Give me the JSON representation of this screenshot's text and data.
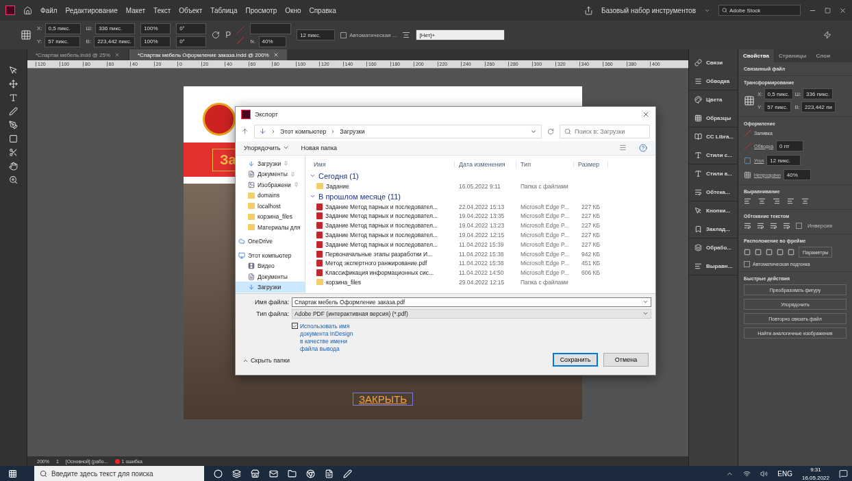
{
  "menu_bar": {
    "items": [
      "Файл",
      "Редактирование",
      "Макет",
      "Текст",
      "Объект",
      "Таблица",
      "Просмотр",
      "Окно",
      "Справка"
    ],
    "workspace": "Базовый набор инструментов",
    "search": {
      "placeholder": "Adobe Stock"
    }
  },
  "control_bar": {
    "fields": [
      {
        "label": "X:",
        "value": "0,5 пикс."
      },
      {
        "label": "Y:",
        "value": "57 пикс."
      },
      {
        "label": "Ш:",
        "value": "336 пикс."
      },
      {
        "label": "В:",
        "value": "223,442 пикс."
      }
    ],
    "scales": [
      "100%",
      "100%"
    ],
    "angles": [
      "0°",
      "0°"
    ],
    "glyph": "P",
    "fx": "fx.",
    "opacity": "40%",
    "corner": "12 пикс.",
    "autofit": {
      "label": "Автоматическая ...",
      "checked": false
    },
    "style": "[Нет]+"
  },
  "document_tabs": [
    {
      "label": "*Спартак мебель.indd @ 25%",
      "selected": false
    },
    {
      "label": "*Спартак мебель Оформление заказа.indd @ 200%",
      "selected": true
    }
  ],
  "ruler": [
    "120",
    "100",
    "80",
    "60",
    "40",
    "20",
    "0",
    "20",
    "40",
    "60",
    "80",
    "100",
    "120",
    "140",
    "160",
    "180",
    "200",
    "220",
    "240",
    "260",
    "280",
    "300",
    "320",
    "340",
    "360",
    "380",
    "400"
  ],
  "page": {
    "banner_text": "За",
    "button_text": "ЗАКРЫТЬ"
  },
  "status_bar": {
    "zoom": "200%",
    "page": "1",
    "master": "[Основной] (рабо...",
    "errors": "1 ошибка"
  },
  "dialog": {
    "title": "Экспорт",
    "path": [
      "Этот компьютер",
      "Загрузки"
    ],
    "search": {
      "placeholder": "Поиск в: Загрузки"
    },
    "organize": "Упорядочить",
    "new_folder": "Новая папка",
    "nav": [
      {
        "label": "Загрузки",
        "kind": "download",
        "pinned": true,
        "selected": false
      },
      {
        "label": "Документы",
        "kind": "document",
        "pinned": true,
        "selected": false
      },
      {
        "label": "Изображени",
        "kind": "image",
        "pinned": true,
        "selected": false
      },
      {
        "label": "domains",
        "kind": "folder",
        "pinned": false,
        "selected": false
      },
      {
        "label": "localhost",
        "kind": "folder",
        "pinned": false,
        "selected": false
      },
      {
        "label": "корзина_files",
        "kind": "folder",
        "pinned": false,
        "selected": false
      },
      {
        "label": "Материалы для",
        "kind": "folder",
        "pinned": false,
        "selected": false
      },
      {
        "label": "OneDrive",
        "kind": "cloud",
        "pinned": false,
        "selected": false
      },
      {
        "label": "Этот компьютер",
        "kind": "computer",
        "pinned": false,
        "selected": false
      },
      {
        "label": "Видео",
        "kind": "video",
        "pinned": false,
        "selected": false
      },
      {
        "label": "Документы",
        "kind": "document",
        "pinned": false,
        "selected": false
      },
      {
        "label": "Загрузки",
        "kind": "download",
        "pinned": false,
        "selected": true
      }
    ],
    "columns": [
      "Имя",
      "Дата изменения",
      "Тип",
      "Размер"
    ],
    "groups": [
      {
        "label": "Сегодня (1)",
        "rows": [
          {
            "name": "Задание",
            "kind": "folder",
            "date": "16.05.2022 9:11",
            "type": "Папка с файлами",
            "size": ""
          }
        ]
      },
      {
        "label": "В прошлом месяце (11)",
        "rows": [
          {
            "name": "Задание Метод парных и последовател...",
            "kind": "pdf",
            "date": "22.04.2022 15:13",
            "type": "Microsoft Edge P...",
            "size": "227 КБ"
          },
          {
            "name": "Задание Метод парных и последовател...",
            "kind": "pdf",
            "date": "19.04.2022 13:35",
            "type": "Microsoft Edge P...",
            "size": "227 КБ"
          },
          {
            "name": "Задание Метод парных и последовател...",
            "kind": "pdf",
            "date": "19.04.2022 13:23",
            "type": "Microsoft Edge P...",
            "size": "227 КБ"
          },
          {
            "name": "Задание Метод парных и последовател...",
            "kind": "pdf",
            "date": "19.04.2022 12:15",
            "type": "Microsoft Edge P...",
            "size": "227 КБ"
          },
          {
            "name": "Задание Метод парных и последовател...",
            "kind": "pdf",
            "date": "11.04.2022 15:39",
            "type": "Microsoft Edge P...",
            "size": "227 КБ"
          },
          {
            "name": "Первоначальные этапы разработки И...",
            "kind": "pdf",
            "date": "11.04.2022 15:38",
            "type": "Microsoft Edge P...",
            "size": "942 КБ"
          },
          {
            "name": "Метод экспертного ранжирование.pdf",
            "kind": "pdf",
            "date": "11.04.2022 15:38",
            "type": "Microsoft Edge P...",
            "size": "451 КБ"
          },
          {
            "name": "Классификация информационных сис...",
            "kind": "pdf",
            "date": "11.04.2022 14:50",
            "type": "Microsoft Edge P...",
            "size": "606 КБ"
          },
          {
            "name": "корзина_files",
            "kind": "folder",
            "date": "29.04.2022 12:15",
            "type": "Папка с файлами",
            "size": ""
          }
        ]
      }
    ],
    "file_name": {
      "label": "Имя файла:",
      "value": "Спартак мебель Оформление заказа.pdf"
    },
    "file_type": {
      "label": "Тип файла:",
      "value": "Adobe PDF (интерактивная версия) (*.pdf)"
    },
    "use_doc_name": {
      "label": "Использовать имя документа InDesign в качестве имени файла вывода",
      "checked": true
    },
    "hide_folders": "Скрыть папки",
    "buttons": [
      {
        "label": "Сохранить",
        "kind": "primary"
      },
      {
        "label": "Отмена",
        "kind": "normal"
      }
    ]
  },
  "panel_dock": [
    {
      "label": "Связи",
      "kind": "links"
    },
    {
      "label": "Обводка",
      "kind": "stroke"
    },
    {
      "label": "Цвета",
      "kind": "color"
    },
    {
      "label": "Образцы",
      "kind": "swatch"
    },
    {
      "label": "CC Libra...",
      "kind": "library"
    },
    {
      "label": "Стили с...",
      "kind": "style"
    },
    {
      "label": "Стили а...",
      "kind": "style"
    },
    {
      "label": "Обтека...",
      "kind": "wrap"
    },
    {
      "label": "Кнопки...",
      "kind": "button"
    },
    {
      "label": "Заклад...",
      "kind": "bookmark"
    },
    {
      "label": "Обрабо...",
      "kind": "layers"
    },
    {
      "label": "Выравн...",
      "kind": "align"
    }
  ],
  "properties": {
    "tabs": [
      {
        "label": "Свойства",
        "selected": true
      },
      {
        "label": "Страницы",
        "selected": false
      },
      {
        "label": "Слои",
        "selected": false
      }
    ],
    "linked_file": "Связанный файл",
    "transform_title": "Трансформирование",
    "transform": [
      {
        "label": "X:",
        "value": "0,5 пикс."
      },
      {
        "label": "Ш:",
        "value": "336 пикс."
      },
      {
        "label": "Y:",
        "value": "57 пикс."
      },
      {
        "label": "В:",
        "value": "223,442 пи"
      }
    ],
    "appearance_title": "Оформление",
    "fill": "Заливка",
    "stroke": {
      "label": "Обводка",
      "value": "0 пт"
    },
    "corner": {
      "label": "Угол",
      "value": "12 пикс."
    },
    "opacity": {
      "label": "Непрозрачн",
      "value": "40%"
    },
    "align_title": "Выравнивание",
    "wrap_title": "Обтекание текстом",
    "invert": {
      "label": "Инверсия",
      "checked": false
    },
    "frame_title": "Расположение во фрейме",
    "frame_button": "Параметры",
    "auto_fit": {
      "label": "Автоматическая подгонка",
      "checked": false
    },
    "quick_title": "Быстрые действия",
    "quick_actions": [
      "Преобразовать фигуру",
      "Упорядочить",
      "Повторно связать файл",
      "Найти аналогичные изображения"
    ]
  },
  "taskbar": {
    "search": {
      "placeholder": "Введите здесь текст для поиска"
    },
    "language": "ENG",
    "time": "9:31",
    "date": "16.05.2022"
  }
}
